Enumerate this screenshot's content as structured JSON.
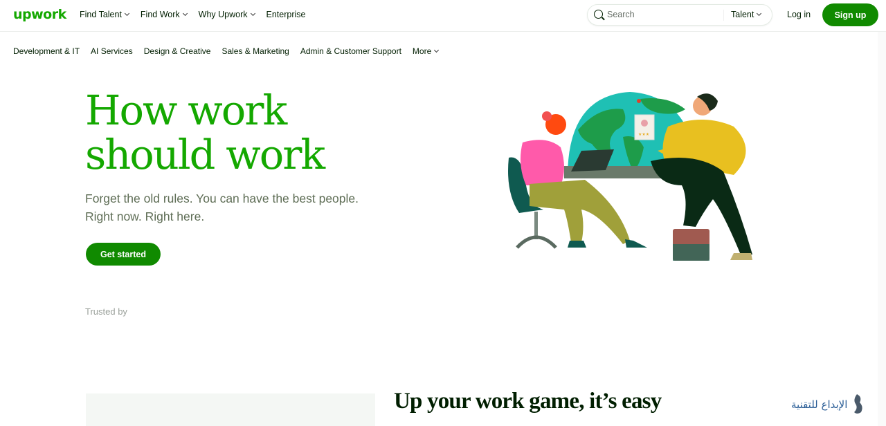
{
  "header": {
    "logo": "upwork",
    "nav": [
      {
        "label": "Find Talent",
        "has_dropdown": true
      },
      {
        "label": "Find Work",
        "has_dropdown": true
      },
      {
        "label": "Why Upwork",
        "has_dropdown": true
      },
      {
        "label": "Enterprise",
        "has_dropdown": false
      }
    ],
    "search": {
      "placeholder": "Search",
      "value": "",
      "type_selected": "Talent"
    },
    "login_label": "Log in",
    "signup_label": "Sign up"
  },
  "categories": [
    {
      "label": "Development & IT"
    },
    {
      "label": "AI Services"
    },
    {
      "label": "Design & Creative"
    },
    {
      "label": "Sales & Marketing"
    },
    {
      "label": "Admin & Customer Support"
    },
    {
      "label": "More",
      "has_dropdown": true
    }
  ],
  "hero": {
    "title_line1": "How work",
    "title_line2": "should work",
    "subtitle_line1": "Forget the old rules. You can have the best people.",
    "subtitle_line2": "Right now. Right here.",
    "cta_label": "Get started",
    "illustration": "two-people-working-globe-illustration"
  },
  "trusted_by_label": "Trusted by",
  "section2": {
    "title": "Up your work game, it’s easy"
  },
  "watermark": {
    "text": "الإبداع للتقنية"
  },
  "colors": {
    "brand_green": "#14a800",
    "button_green": "#108a00",
    "text_dark": "#001e00",
    "text_muted": "#5e6d55"
  }
}
